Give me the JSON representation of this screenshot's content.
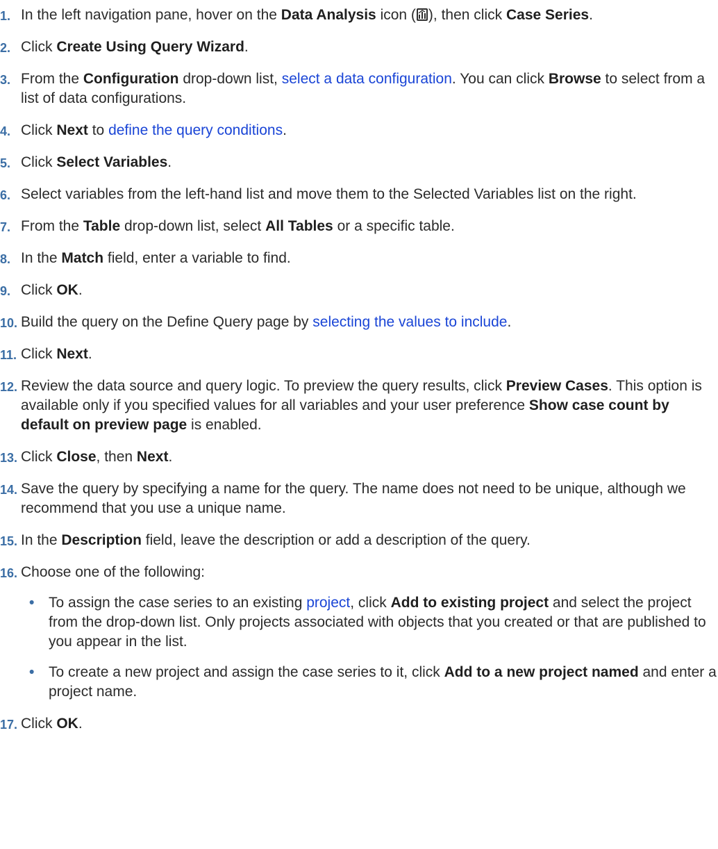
{
  "steps": [
    {
      "num": "1.",
      "parts": [
        {
          "t": "In the left navigation pane, hover on the "
        },
        {
          "t": "Data Analysis",
          "b": true
        },
        {
          "t": " icon ("
        },
        {
          "icon": "data-analysis-icon"
        },
        {
          "t": "), then click "
        },
        {
          "t": "Case Series",
          "b": true
        },
        {
          "t": "."
        }
      ]
    },
    {
      "num": "2.",
      "parts": [
        {
          "t": "Click "
        },
        {
          "t": "Create Using Query Wizard",
          "b": true
        },
        {
          "t": "."
        }
      ]
    },
    {
      "num": "3.",
      "parts": [
        {
          "t": "From the "
        },
        {
          "t": "Configuration",
          "b": true
        },
        {
          "t": " drop-down list, "
        },
        {
          "t": "select a data configuration",
          "link": true
        },
        {
          "t": ". You can click "
        },
        {
          "t": "Browse",
          "b": true
        },
        {
          "t": " to select from a list of data configurations."
        }
      ]
    },
    {
      "num": "4.",
      "parts": [
        {
          "t": "Click "
        },
        {
          "t": "Next",
          "b": true
        },
        {
          "t": " to "
        },
        {
          "t": "define the query conditions",
          "link": true
        },
        {
          "t": "."
        }
      ]
    },
    {
      "num": "5.",
      "parts": [
        {
          "t": "Click "
        },
        {
          "t": "Select Variables",
          "b": true
        },
        {
          "t": "."
        }
      ]
    },
    {
      "num": "6.",
      "parts": [
        {
          "t": "Select variables from the left-hand list and move them to the Selected Variables list on the right."
        }
      ]
    },
    {
      "num": "7.",
      "parts": [
        {
          "t": "From the "
        },
        {
          "t": "Table",
          "b": true
        },
        {
          "t": " drop-down list, select "
        },
        {
          "t": "All Tables",
          "b": true
        },
        {
          "t": " or a specific table."
        }
      ]
    },
    {
      "num": "8.",
      "parts": [
        {
          "t": "In the "
        },
        {
          "t": "Match",
          "b": true
        },
        {
          "t": " field, enter a variable to find."
        }
      ]
    },
    {
      "num": "9.",
      "parts": [
        {
          "t": "Click "
        },
        {
          "t": "OK",
          "b": true
        },
        {
          "t": "."
        }
      ]
    },
    {
      "num": "10.",
      "parts": [
        {
          "t": "Build the query on the Define Query page by "
        },
        {
          "t": "selecting the values to include",
          "link": true
        },
        {
          "t": "."
        }
      ]
    },
    {
      "num": "11.",
      "parts": [
        {
          "t": "Click "
        },
        {
          "t": "Next",
          "b": true
        },
        {
          "t": "."
        }
      ]
    },
    {
      "num": "12.",
      "parts": [
        {
          "t": "Review the data source and query logic. To preview the query results, click "
        },
        {
          "t": "Preview Cases",
          "b": true
        },
        {
          "t": ". This option is available only if you specified values for all variables and your user preference "
        },
        {
          "t": "Show case count by default on preview page",
          "b": true
        },
        {
          "t": " is enabled."
        }
      ]
    },
    {
      "num": "13.",
      "parts": [
        {
          "t": "Click "
        },
        {
          "t": "Close",
          "b": true
        },
        {
          "t": ", then "
        },
        {
          "t": "Next",
          "b": true
        },
        {
          "t": "."
        }
      ]
    },
    {
      "num": "14.",
      "parts": [
        {
          "t": "Save the query by specifying a name for the query. The name does not need to be unique, although we recommend that you use a unique name."
        }
      ]
    },
    {
      "num": "15.",
      "parts": [
        {
          "t": "In the "
        },
        {
          "t": "Description",
          "b": true
        },
        {
          "t": " field, leave the description or add a description of the query."
        }
      ]
    },
    {
      "num": "16.",
      "parts": [
        {
          "t": "Choose one of the following:"
        }
      ],
      "bullets": [
        {
          "parts": [
            {
              "t": "To assign the case series to an existing "
            },
            {
              "t": "project",
              "link": true
            },
            {
              "t": ", click "
            },
            {
              "t": "Add to existing project",
              "b": true
            },
            {
              "t": " and select the project from the drop-down list. Only projects associated with objects that you created or that are published to you appear in the list."
            }
          ]
        },
        {
          "parts": [
            {
              "t": "To create a new project and assign the case series to it, click "
            },
            {
              "t": "Add to a new project named",
              "b": true
            },
            {
              "t": " and enter a project name."
            }
          ]
        }
      ]
    },
    {
      "num": "17.",
      "parts": [
        {
          "t": "Click "
        },
        {
          "t": "OK",
          "b": true
        },
        {
          "t": "."
        }
      ]
    }
  ],
  "bullet_glyph": "•",
  "colors": {
    "link": "#1a45d6",
    "step_number": "#3b6ea5",
    "text": "#2b2b2b"
  }
}
